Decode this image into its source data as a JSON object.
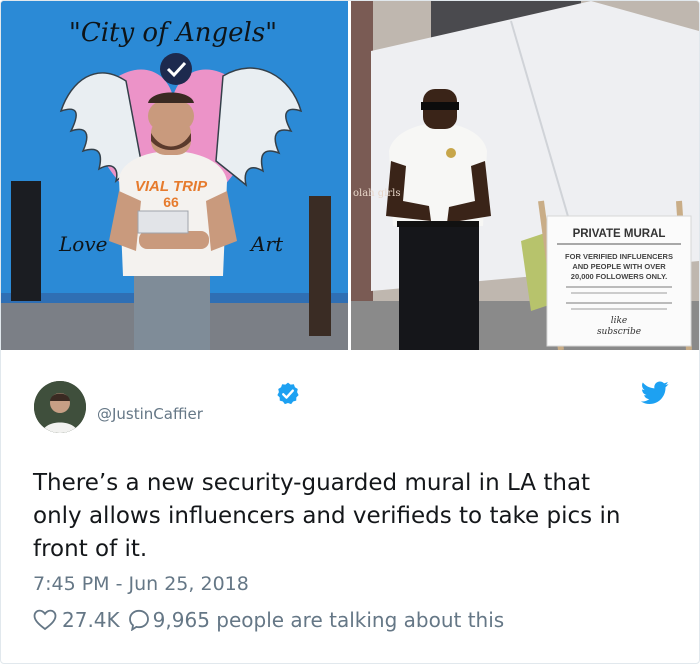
{
  "photos": {
    "left": {
      "mural_title": "\"City of Angels\"",
      "mural_left_word": "Love",
      "mural_right_word": "Art",
      "shirt_text_top": "VIAL TRIP",
      "shirt_text_bottom": "66"
    },
    "right": {
      "sign_title": "PRIVATE MURAL",
      "sign_line1": "FOR VERIFIED INFLUENCERS",
      "sign_line2": "AND PEOPLE WITH OVER",
      "sign_line3": "20,000 FOLLOWERS ONLY.",
      "sign_footer_line1": "like",
      "sign_footer_line2": "subscribe",
      "wall_text": "olah girls"
    }
  },
  "tweet": {
    "handle": "@JustinCaffier",
    "text": "There’s a new security-guarded mural in LA that\nonly allows influencers and verifieds to take pics in\nfront of it.",
    "timestamp": "7:45 PM - Jun 25, 2018",
    "likes": "27.4K",
    "talking": "9,965 people are talking about this"
  },
  "colors": {
    "verified": "#1da1f2",
    "twitter_blue": "#1da1f2",
    "muted": "#657786",
    "text": "#14171a"
  },
  "icons": {
    "verified": "verified-badge-icon",
    "bird": "twitter-bird-icon",
    "heart": "heart-icon",
    "reply": "speech-bubble-icon"
  }
}
